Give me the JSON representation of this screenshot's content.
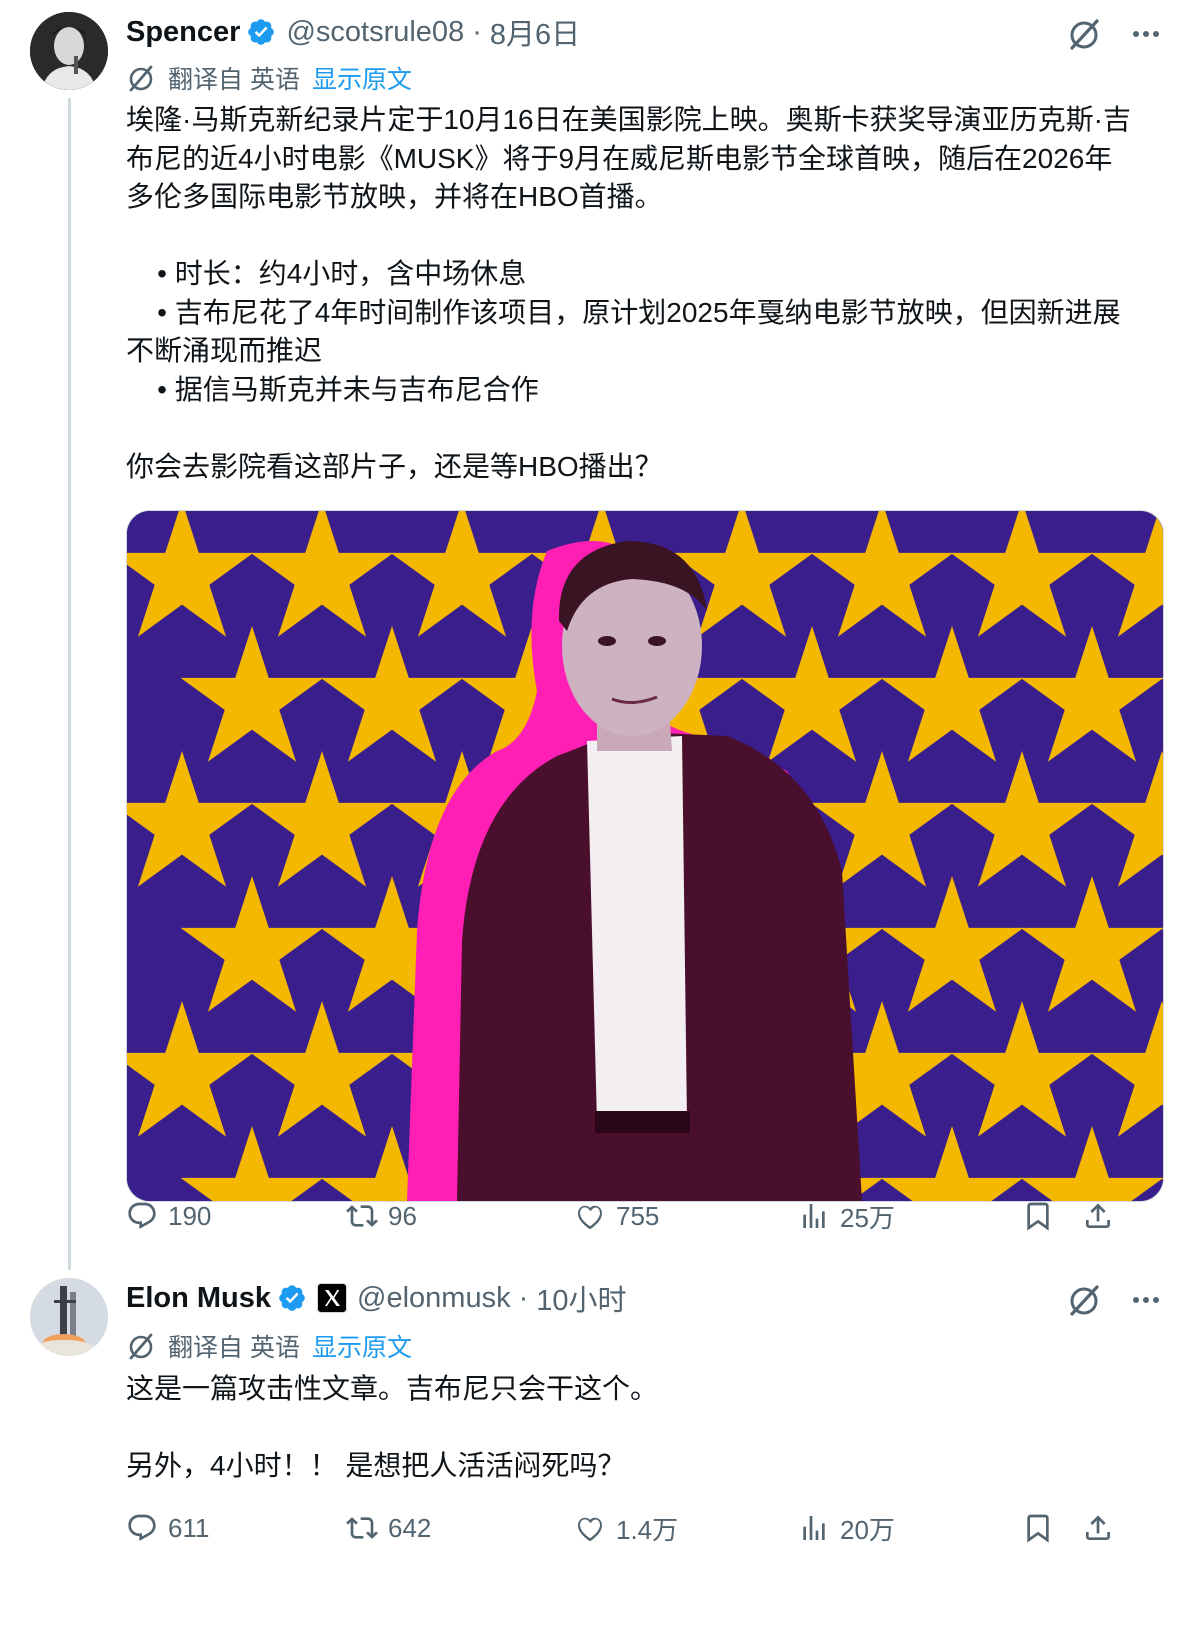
{
  "tweet1": {
    "name": "Spencer",
    "handle": "@scotsrule08",
    "sep": "·",
    "date": "8月6日",
    "translate": {
      "prefix": "翻译自 英语",
      "show_original": "显示原文"
    },
    "text": "埃隆·马斯克新纪录片定于10月16日在美国影院上映。奥斯卡获奖导演亚历克斯·吉布尼的近4小时电影《MUSK》将于9月在威尼斯电影节全球首映，随后在2026年多伦多国际电影节放映，并将在HBO首播。\n\n    • 时长：约4小时，含中场休息\n    • 吉布尼花了4年时间制作该项目，原计划2025年戛纳电影节放映，但因新进展不断涌现而推迟\n    • 据信马斯克并未与吉布尼合作\n\n你会去影院看这部片子，还是等HBO播出？",
    "stats": {
      "replies": "190",
      "reposts": "96",
      "likes": "755",
      "views": "25万"
    }
  },
  "tweet2": {
    "name": "Elon Musk",
    "handle": "@elonmusk",
    "sep": "·",
    "date": "10小时",
    "translate": {
      "prefix": "翻译自 英语",
      "show_original": "显示原文"
    },
    "text": "这是一篇攻击性文章。吉布尼只会干这个。\n\n另外，4小时！！ 是想把人活活闷死吗？",
    "stats": {
      "replies": "611",
      "reposts": "642",
      "likes": "1.4万",
      "views": "20万"
    }
  },
  "icons": {
    "verified": "verified-badge-icon",
    "grok": "grok-icon",
    "more": "more-icon",
    "translate": "translate-icon",
    "reply": "reply-icon",
    "repost": "repost-icon",
    "like": "like-icon",
    "views": "views-icon",
    "bookmark": "bookmark-icon",
    "share": "share-icon"
  },
  "colors": {
    "link": "#1d9bf0",
    "muted": "#536471",
    "text": "#0f1419",
    "media_bg": "#3a1f8c",
    "media_star": "#f5b800",
    "media_accent": "#ff1fb4"
  }
}
